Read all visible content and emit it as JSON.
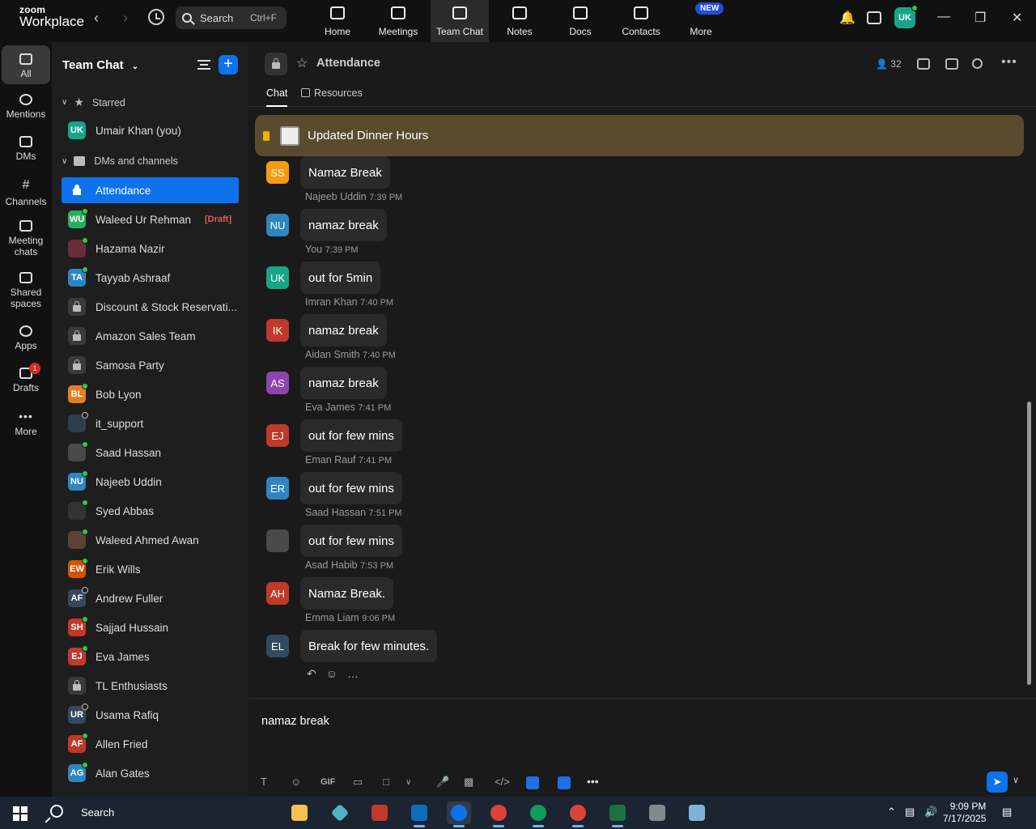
{
  "topbar": {
    "logo_line1": "zoom",
    "logo_line2": "Workplace",
    "search_label": "Search",
    "search_shortcut": "Ctrl+F",
    "tabs": [
      {
        "label": "Home"
      },
      {
        "label": "Meetings"
      },
      {
        "label": "Team Chat"
      },
      {
        "label": "Notes"
      },
      {
        "label": "Docs"
      },
      {
        "label": "Contacts"
      },
      {
        "label": "More"
      }
    ],
    "new_badge": "NEW",
    "avatar_initials": "UK"
  },
  "rail": {
    "items": [
      {
        "label": "All"
      },
      {
        "label": "Mentions"
      },
      {
        "label": "DMs"
      },
      {
        "label": "Channels"
      },
      {
        "label": "Meeting chats"
      },
      {
        "label": "Shared spaces"
      },
      {
        "label": "Apps"
      },
      {
        "label": "Drafts",
        "badge": "1"
      },
      {
        "label": "More"
      }
    ]
  },
  "sidebar": {
    "title": "Team Chat",
    "starred_label": "Starred",
    "starred": [
      {
        "initials": "UK",
        "name": "Umair Khan (you)",
        "color": "#17a589"
      }
    ],
    "dms_label": "DMs and channels",
    "items": [
      {
        "name": "Attendance",
        "type": "lock"
      },
      {
        "initials": "WU",
        "name": "Waleed Ur Rehman",
        "color": "#27ae60",
        "draft": "[Draft]"
      },
      {
        "initials": "",
        "name": "Hazama Nazir",
        "color": "#6b2d3a"
      },
      {
        "initials": "TA",
        "name": "Tayyab Ashraaf",
        "color": "#2e86c1"
      },
      {
        "name": "Discount & Stock Reservati...",
        "type": "lock"
      },
      {
        "name": "Amazon Sales Team",
        "type": "lock"
      },
      {
        "name": "Samosa Party",
        "type": "lock"
      },
      {
        "initials": "BL",
        "name": "Bob Lyon",
        "color": "#e67e22"
      },
      {
        "initials": "",
        "name": "it_support",
        "color": "#2c3e50"
      },
      {
        "initials": "",
        "name": "Saad Hassan",
        "color": "#4a4a4a"
      },
      {
        "initials": "NU",
        "name": "Najeeb Uddin",
        "color": "#2e86c1"
      },
      {
        "initials": "",
        "name": "Syed Abbas",
        "color": "#333333"
      },
      {
        "initials": "",
        "name": "Waleed Ahmed Awan",
        "color": "#5d4037"
      },
      {
        "initials": "EW",
        "name": "Erik Wills",
        "color": "#d35400"
      },
      {
        "initials": "AF",
        "name": "Andrew Fuller",
        "color": "#34495e"
      },
      {
        "initials": "SH",
        "name": "Sajjad Hussain",
        "color": "#c0392b"
      },
      {
        "initials": "EJ",
        "name": "Eva James",
        "color": "#c0392b"
      },
      {
        "name": "TL Enthusiasts",
        "type": "lock"
      },
      {
        "initials": "UR",
        "name": "Usama Rafiq",
        "color": "#34495e"
      },
      {
        "initials": "AF",
        "name": "Allen Fried",
        "color": "#c0392b"
      },
      {
        "initials": "AG",
        "name": "Alan Gates",
        "color": "#2e86c1"
      }
    ]
  },
  "channel": {
    "name": "Attendance",
    "member_count": "32",
    "tabs": [
      "Chat",
      "Resources"
    ],
    "pinned": "Updated Dinner Hours"
  },
  "messages": [
    {
      "initials": "SS",
      "color": "#f39c12",
      "sender": "",
      "time": "",
      "text": "Namaz Break"
    },
    {
      "initials": "NU",
      "color": "#2e86c1",
      "sender": "Najeeb Uddin",
      "time": "7:39 PM",
      "text": "namaz break"
    },
    {
      "initials": "UK",
      "color": "#17a589",
      "sender": "You",
      "time": "7:39 PM",
      "text": "out for 5min"
    },
    {
      "initials": "IK",
      "color": "#c0392b",
      "sender": "Imran Khan",
      "time": "7:40 PM",
      "text": "namaz break"
    },
    {
      "initials": "AS",
      "color": "#8e44ad",
      "sender": "Aidan Smith",
      "time": "7:40 PM",
      "text": "namaz break"
    },
    {
      "initials": "EJ",
      "color": "#c0392b",
      "sender": "Eva James",
      "time": "7:41 PM",
      "text": "out for few mins"
    },
    {
      "initials": "ER",
      "color": "#2e86c1",
      "sender": "Eman Rauf",
      "time": "7:41 PM",
      "text": "out for few mins"
    },
    {
      "initials": "",
      "color": "#4a4a4a",
      "sender": "Saad Hassan",
      "time": "7:51 PM",
      "text": "out for few  mins"
    },
    {
      "initials": "AH",
      "color": "#c0392b",
      "sender": "Asad Habib",
      "time": "7:53 PM",
      "text": "Namaz Break."
    },
    {
      "initials": "EL",
      "color": "#34495e",
      "sender": "Emma Liam",
      "time": "9:06 PM",
      "text": "Break for few minutes."
    }
  ],
  "composer": {
    "value": "namaz break",
    "gif_label": "GIF"
  },
  "taskbar": {
    "search_label": "Search",
    "time": "9:09 PM",
    "date": "7/17/2025"
  }
}
